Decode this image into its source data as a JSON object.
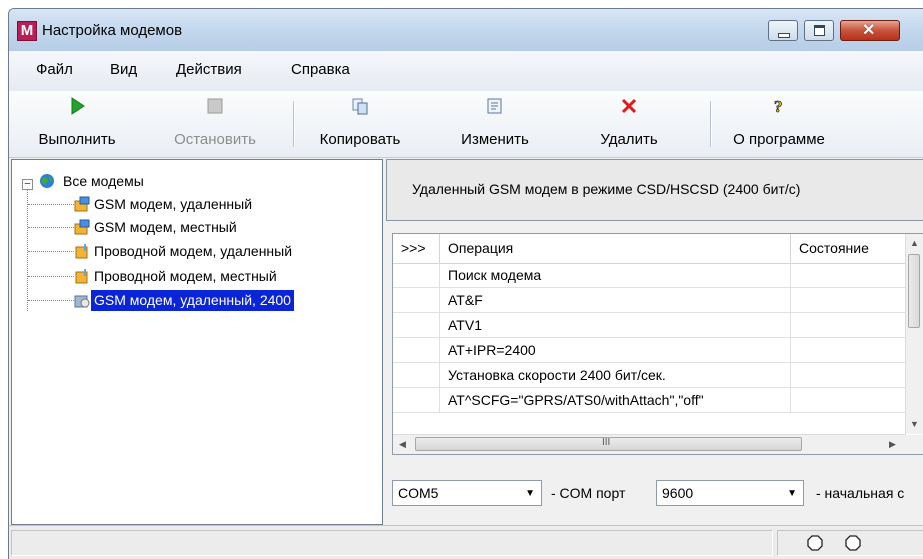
{
  "window": {
    "title": "Настройка модемов",
    "icon_letter": "M",
    "controls": [
      "minimize-icon",
      "maximize-icon",
      "close-icon"
    ]
  },
  "menu": [
    "Файл",
    "Вид",
    "Действия",
    "Справка"
  ],
  "toolbar": {
    "run": {
      "label": "Выполнить",
      "icon": "play-icon",
      "enabled": true
    },
    "stop": {
      "label": "Остановить",
      "icon": "stop-icon",
      "enabled": false
    },
    "copy": {
      "label": "Копировать",
      "icon": "copy-icon",
      "enabled": true
    },
    "edit": {
      "label": "Изменить",
      "icon": "edit-icon",
      "enabled": true
    },
    "delete": {
      "label": "Удалить",
      "icon": "delete-icon",
      "enabled": true
    },
    "about": {
      "label": "О программе",
      "icon": "help-icon",
      "enabled": true
    }
  },
  "tree": {
    "root": "Все модемы",
    "items": [
      "GSM модем, удаленный",
      "GSM модем, местный",
      "Проводной модем, удаленный",
      "Проводной модем, местный",
      "GSM модем, удаленный, 2400"
    ],
    "selected_index": 4
  },
  "details": {
    "header": "Удаленный GSM модем в режиме CSD/HSCSD (2400 бит/с)",
    "columns": [
      ">>>",
      "Операция",
      "Состояние"
    ],
    "rows": [
      {
        "marker": "",
        "operation": "Поиск модема",
        "state": ""
      },
      {
        "marker": "",
        "operation": "AT&F",
        "state": ""
      },
      {
        "marker": "",
        "operation": "ATV1",
        "state": ""
      },
      {
        "marker": "",
        "operation": "AT+IPR=2400",
        "state": ""
      },
      {
        "marker": "",
        "operation": "Установка скорости 2400 бит/сек.",
        "state": ""
      },
      {
        "marker": "",
        "operation": "AT^SCFG=\"GPRS/ATS0/withAttach\",\"off\"",
        "state": ""
      }
    ],
    "hscroll_glyph": "III"
  },
  "bottom": {
    "port_value": "COM5",
    "port_label": "- COM порт",
    "speed_value": "9600",
    "speed_label": "- начальная с"
  },
  "colors": {
    "selection": "#0a24d8",
    "title_gradient": "#c2d6ec",
    "close_button": "#c7533b",
    "play_green": "#22a32a",
    "delete_red": "#e01919"
  }
}
